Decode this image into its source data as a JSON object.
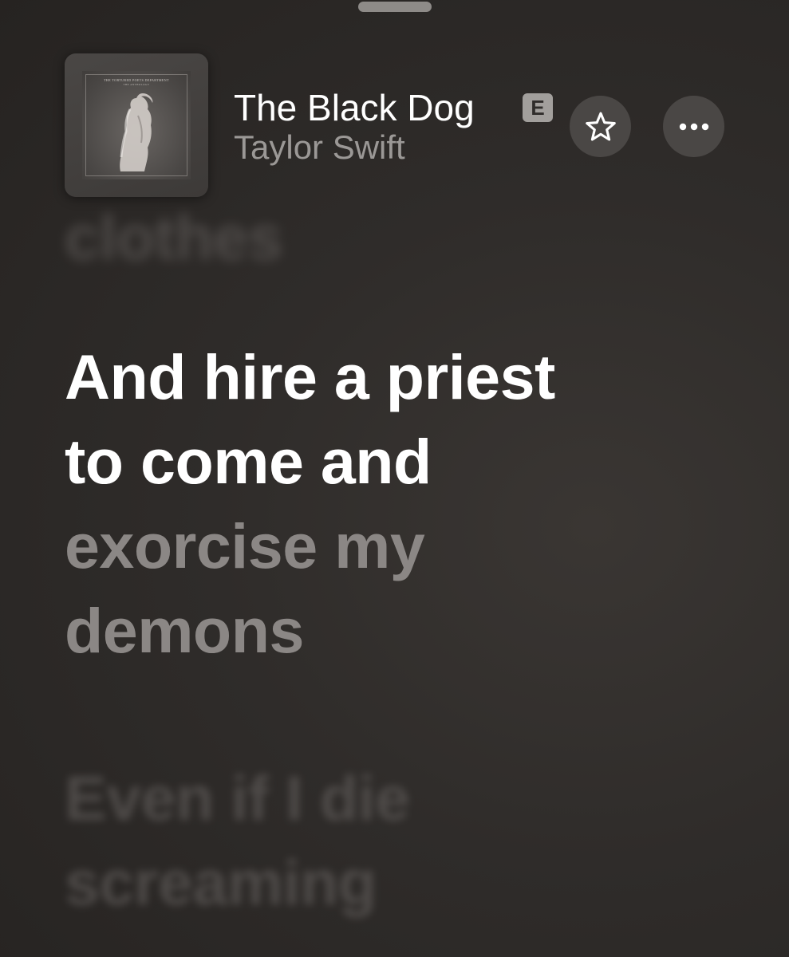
{
  "now_playing": {
    "title": "The Black Dog",
    "explicit_badge": "E",
    "artist": "Taylor Swift",
    "artwork": {
      "title": "THE TORTURED POETS DEPARTMENT",
      "subtitle": "THE ANTHOLOGY"
    }
  },
  "buttons": {
    "favorite_icon": "star-icon",
    "more_icon": "ellipsis-icon"
  },
  "lyrics": {
    "previous": "clothes",
    "current_sung": "And hire a priest\nto come and",
    "current_upcoming": "exorcise my\ndemons",
    "next": "Even if I die\nscreaming"
  },
  "colors": {
    "background": "#2f2c2a",
    "active_lyric": "#ffffff",
    "upcoming_lyric": "#8b8785",
    "dim_lyric": "#5a5654",
    "button_bg": "#4a4745"
  }
}
